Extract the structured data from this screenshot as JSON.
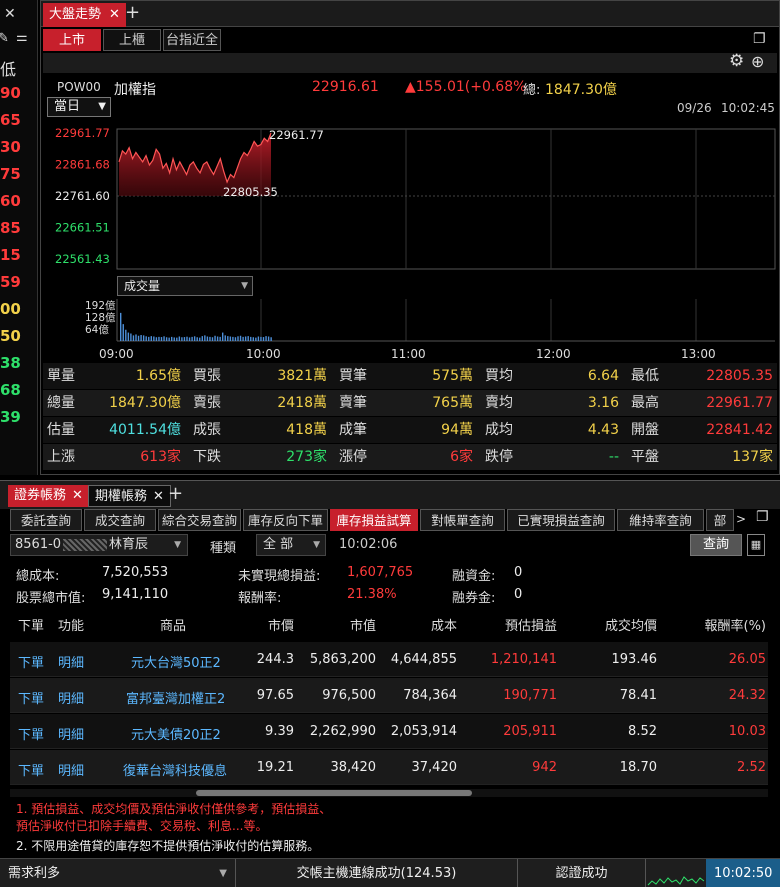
{
  "left_strip": {
    "header_label": "低",
    "values": [
      "90",
      "65",
      "30",
      "75",
      "60",
      "85",
      "15",
      "59",
      "00",
      "50",
      "38",
      "68",
      "39"
    ],
    "value_colors": [
      "#ff3b3b",
      "#ff3b3b",
      "#ff3b3b",
      "#ff3b3b",
      "#ff3b3b",
      "#ff3b3b",
      "#ff3b3b",
      "#ff3b3b",
      "#f2d14a",
      "#f2d14a",
      "#2ee06a",
      "#2ee06a",
      "#2ee06a"
    ]
  },
  "top_window": {
    "tab_label": "大盤走勢",
    "sub_tabs": [
      "上市",
      "上櫃",
      "台指近全"
    ],
    "active_sub_tab": "上市",
    "symbol_code": "POW00",
    "symbol_name": "加權指",
    "price": "22916.61",
    "change": "▲155.01(+0.68%",
    "total_label": "總:",
    "total_value": "1847.30億",
    "period_select": "當日",
    "date": "09/26",
    "time": "10:02:45",
    "volume_select": "成交量"
  },
  "chart_data": {
    "type": "line",
    "title": "",
    "y_ticks": [
      "22961.77",
      "22861.68",
      "22761.60",
      "22661.51",
      "22561.43"
    ],
    "y_tick_colors": [
      "#ff3b3b",
      "#ff3b3b",
      "#eeeeee",
      "#2ee06a",
      "#2ee06a"
    ],
    "ylim": [
      22561.43,
      22961.77
    ],
    "x_ticks": [
      "09:00",
      "10:00",
      "11:00",
      "12:00",
      "13:00"
    ],
    "high_label": "22961.77",
    "low_label": "22805.35",
    "reference": 22761.6,
    "series": [
      {
        "values": [
          22870,
          22905,
          22895,
          22915,
          22880,
          22900,
          22885,
          22870,
          22890,
          22860,
          22875,
          22910,
          22895,
          22850,
          22865,
          22835,
          22880,
          22845,
          22870,
          22850,
          22830,
          22860,
          22870,
          22850,
          22835,
          22862,
          22870,
          22848,
          22830,
          22855,
          22880,
          22840,
          22806,
          22830,
          22820,
          22850,
          22880,
          22900,
          22890,
          22910,
          22935,
          22920,
          22925,
          22945,
          22935,
          22962
        ]
      }
    ],
    "volume": {
      "y_ticks": [
        "192億",
        "128億",
        "64億"
      ],
      "ylim": [
        0,
        192
      ],
      "values": [
        150,
        90,
        60,
        45,
        40,
        30,
        35,
        28,
        32,
        30,
        25,
        22,
        26,
        24,
        20,
        22,
        21,
        25,
        20,
        18,
        22,
        19,
        18,
        24,
        20,
        21,
        23,
        19,
        22,
        25,
        20,
        18,
        26,
        30,
        24,
        22,
        20,
        28,
        24,
        22,
        45,
        30,
        26,
        24,
        22,
        20,
        25,
        28,
        22,
        24,
        26,
        22,
        20,
        18,
        24,
        22,
        21,
        26,
        24,
        20
      ]
    }
  },
  "stats": {
    "rows": [
      [
        [
          "單量",
          "#dddddd"
        ],
        [
          "1.65億",
          "#f2d14a"
        ],
        [
          "買張",
          "#dddddd"
        ],
        [
          "3821萬",
          "#f2d14a"
        ],
        [
          "買筆",
          "#dddddd"
        ],
        [
          "575萬",
          "#f2d14a"
        ],
        [
          "買均",
          "#dddddd"
        ],
        [
          "6.64",
          "#f2d14a"
        ],
        [
          "最低",
          "#dddddd"
        ],
        [
          "22805.35",
          "#ff3b3b"
        ]
      ],
      [
        [
          "總量",
          "#dddddd"
        ],
        [
          "1847.30億",
          "#f2d14a"
        ],
        [
          "賣張",
          "#dddddd"
        ],
        [
          "2418萬",
          "#f2d14a"
        ],
        [
          "賣筆",
          "#dddddd"
        ],
        [
          "765萬",
          "#f2d14a"
        ],
        [
          "賣均",
          "#dddddd"
        ],
        [
          "3.16",
          "#f2d14a"
        ],
        [
          "最高",
          "#dddddd"
        ],
        [
          "22961.77",
          "#ff3b3b"
        ]
      ],
      [
        [
          "估量",
          "#dddddd"
        ],
        [
          "4011.54億",
          "#4fe0e0"
        ],
        [
          "成張",
          "#dddddd"
        ],
        [
          "418萬",
          "#f2d14a"
        ],
        [
          "成筆",
          "#dddddd"
        ],
        [
          "94萬",
          "#f2d14a"
        ],
        [
          "成均",
          "#dddddd"
        ],
        [
          "4.43",
          "#f2d14a"
        ],
        [
          "開盤",
          "#dddddd"
        ],
        [
          "22841.42",
          "#ff3b3b"
        ]
      ],
      [
        [
          "上漲",
          "#dddddd"
        ],
        [
          "613家",
          "#ff3b3b"
        ],
        [
          "下跌",
          "#dddddd"
        ],
        [
          "273家",
          "#2ee06a"
        ],
        [
          "漲停",
          "#dddddd"
        ],
        [
          "6家",
          "#ff3b3b"
        ],
        [
          "跌停",
          "#dddddd"
        ],
        [
          "--",
          "#2ee06a"
        ],
        [
          "平盤",
          "#dddddd"
        ],
        [
          "137家",
          "#f2d14a"
        ]
      ]
    ]
  },
  "bottom_window": {
    "tabs": [
      "證券帳務",
      "期權帳務"
    ],
    "func_tabs": [
      "委託查詢",
      "成交查詢",
      "綜合交易查詢",
      "庫存反向下單",
      "庫存損益試算",
      "對帳單查詢",
      "已實現損益查詢",
      "維持率查詢",
      "部"
    ],
    "active_func_tab": "庫存損益試算",
    "account": "8561-0",
    "account_name": "林育辰",
    "type_label": "種類",
    "type_value": "全  部",
    "query_time": "10:02:06",
    "query_button": "查詢",
    "summary": {
      "total_cost_label": "總成本:",
      "total_cost": "7,520,553",
      "market_value_label": "股票總市值:",
      "market_value": "9,141,110",
      "unrealized_label": "未實現總損益:",
      "unrealized": "1,607,765",
      "return_label": "報酬率:",
      "return": "21.38%",
      "margin_label": "融資金:",
      "margin": "0",
      "short_label": "融券金:",
      "short": "0"
    },
    "columns": [
      "下單",
      "功能",
      "商品",
      "市價",
      "市值",
      "成本",
      "預估損益",
      "成交均價",
      "報酬率(%)"
    ],
    "rows": [
      [
        "下單",
        "明細",
        "元大台灣50正2",
        "244.3",
        "5,863,200",
        "4,644,855",
        "1,210,141",
        "193.46",
        "26.05"
      ],
      [
        "下單",
        "明細",
        "富邦臺灣加權正2",
        "97.65",
        "976,500",
        "784,364",
        "190,771",
        "78.41",
        "24.32"
      ],
      [
        "下單",
        "明細",
        "元大美債20正2",
        "9.39",
        "2,262,990",
        "2,053,914",
        "205,911",
        "8.52",
        "10.03"
      ],
      [
        "下單",
        "明細",
        "復華台灣科技優息",
        "19.21",
        "38,420",
        "37,420",
        "942",
        "18.70",
        "2.52"
      ]
    ],
    "notes": [
      "1. 預估損益、成交均價及預估淨收付僅供參考，預估損益、",
      "預估淨收付已扣除手續費、交易稅、利息...等。",
      "2. 不限用途借貸的庫存恕不提供預估淨收付的估算服務。"
    ]
  },
  "status_bar": {
    "left": "需求利多",
    "connection": "交帳主機連線成功(124.53)",
    "auth": "認證成功",
    "clock": "10:02:50"
  }
}
